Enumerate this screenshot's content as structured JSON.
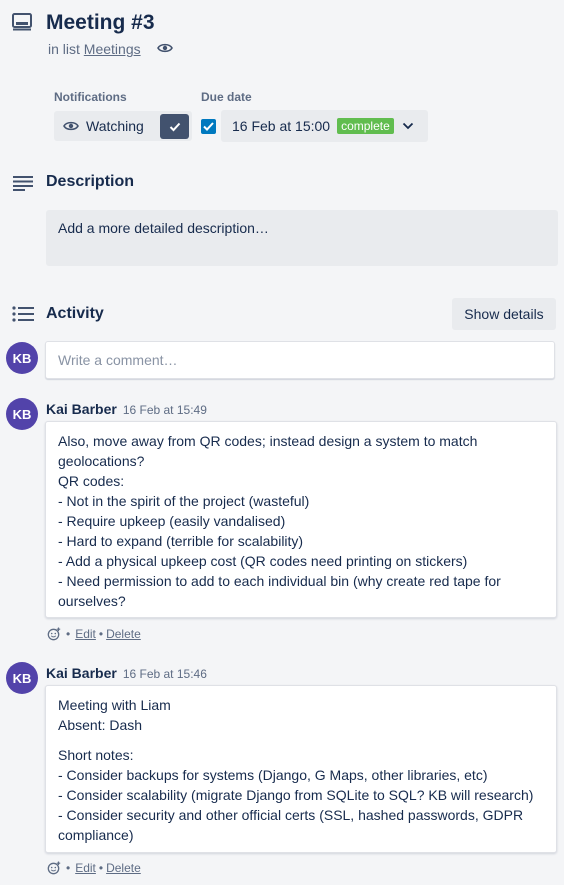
{
  "card": {
    "title": "Meeting #3",
    "in_list_prefix": "in list ",
    "list_name": "Meetings"
  },
  "notifications": {
    "label": "Notifications",
    "watch_label": "Watching"
  },
  "due_date": {
    "label": "Due date",
    "value": "16 Feb at 15:00",
    "status": "complete"
  },
  "description": {
    "title": "Description",
    "placeholder": "Add a more detailed description…"
  },
  "activity": {
    "title": "Activity",
    "show_details": "Show details",
    "comment_placeholder": "Write a comment…",
    "current_user_initials": "KB",
    "comments": [
      {
        "initials": "KB",
        "author": "Kai Barber",
        "time": "16 Feb at 15:49",
        "lines": [
          "Also, move away from QR codes; instead design a system to match geolocations?",
          "QR codes:",
          "- Not in the spirit of the project (wasteful)",
          "- Require upkeep (easily vandalised)",
          "- Hard to expand (terrible for scalability)",
          "- Add a physical upkeep cost (QR codes need printing on stickers)",
          "- Need permission to add to each individual bin (why create red tape for ourselves?"
        ],
        "edit": "Edit",
        "delete": "Delete"
      },
      {
        "initials": "KB",
        "author": "Kai Barber",
        "time": "16 Feb at 15:46",
        "lines_a": [
          "Meeting with Liam",
          "Absent: Dash"
        ],
        "lines_b": [
          "Short notes:",
          "- Consider backups for systems (Django, G Maps, other libraries, etc)",
          "- Consider scalability (migrate Django from SQLite to SQL? KB will research)",
          "- Consider security and other official certs (SSL, hashed passwords, GDPR compliance)"
        ],
        "edit": "Edit",
        "delete": "Delete"
      }
    ]
  },
  "icons": [
    "card-icon",
    "eye-icon",
    "check-icon",
    "chevron-down-icon",
    "description-icon",
    "activity-icon",
    "add-reaction-icon"
  ],
  "colors": {
    "accent": "#0079bf",
    "badge_complete": "#61bd4f",
    "avatar": "#5243aa",
    "watch_check": "#42526e"
  }
}
